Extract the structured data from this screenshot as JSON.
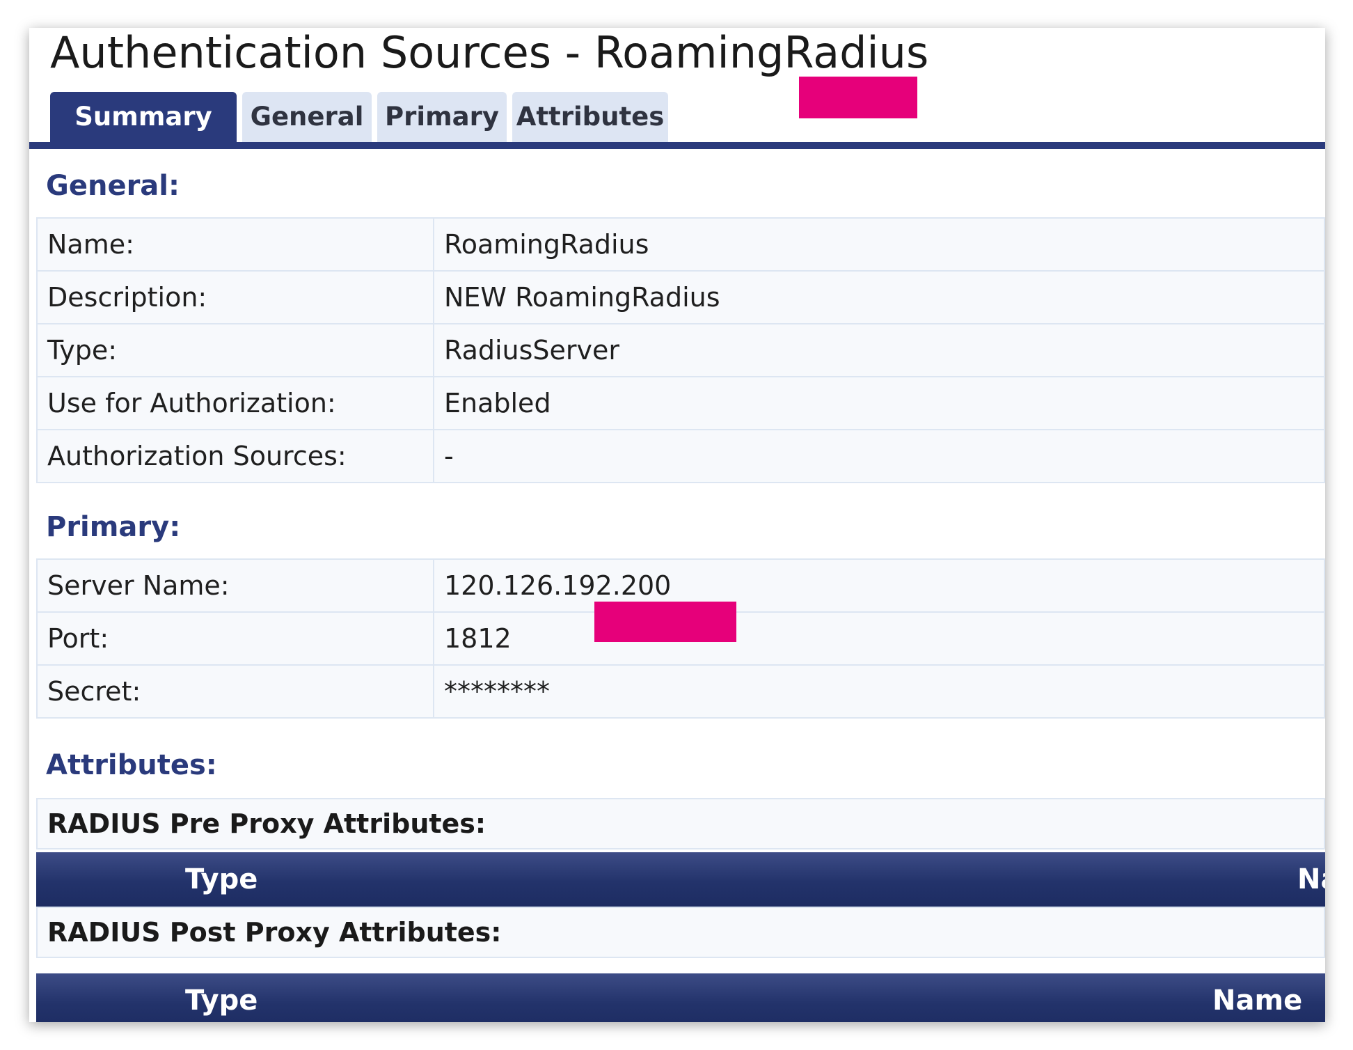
{
  "page": {
    "title": "Authentication Sources - RoamingRadius"
  },
  "tabs": [
    {
      "label": "Summary",
      "active": true
    },
    {
      "label": "General",
      "active": false
    },
    {
      "label": "Primary",
      "active": false
    },
    {
      "label": "Attributes",
      "active": false
    }
  ],
  "general": {
    "heading": "General:",
    "rows": [
      {
        "label": "Name:",
        "value": "RoamingRadius"
      },
      {
        "label": "Description:",
        "value": "NEW RoamingRadius"
      },
      {
        "label": "Type:",
        "value": "RadiusServer"
      },
      {
        "label": "Use for Authorization:",
        "value": "Enabled"
      },
      {
        "label": "Authorization Sources:",
        "value": "-"
      }
    ]
  },
  "primary": {
    "heading": "Primary:",
    "rows": [
      {
        "label": "Server Name:",
        "value": "120.126.192.200"
      },
      {
        "label": "Port:",
        "value": "1812"
      },
      {
        "label": "Secret:",
        "value": "********"
      }
    ]
  },
  "attributes": {
    "heading": "Attributes:",
    "pre_proxy": {
      "title": "RADIUS Pre Proxy Attributes:",
      "col_type": "Type",
      "col_name": "Name"
    },
    "post_proxy": {
      "title": "RADIUS Post Proxy Attributes:",
      "col_type": "Type",
      "col_name": "Name"
    }
  },
  "colors": {
    "accent": "#2a3a7c",
    "heading_text": "#2a3a7c",
    "tab_inactive": "#dde5f3",
    "redaction": "#e6007a"
  }
}
